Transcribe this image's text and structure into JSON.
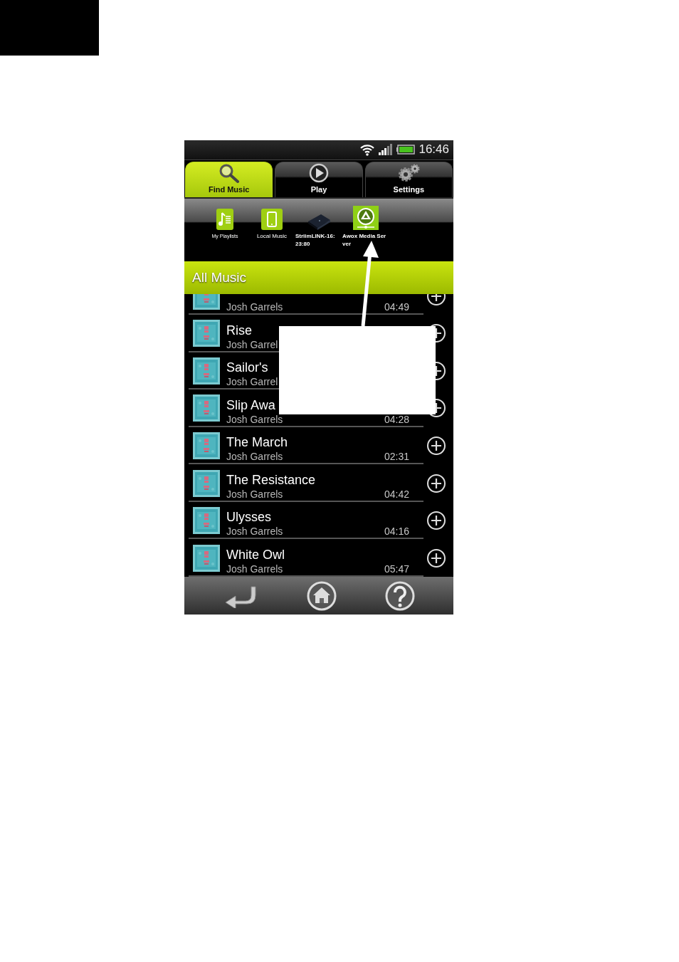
{
  "status_bar": {
    "time": "16:46"
  },
  "tabs": [
    {
      "label": "Find Music",
      "selected": true
    },
    {
      "label": "Play",
      "selected": false
    },
    {
      "label": "Settings",
      "selected": false
    }
  ],
  "sources": [
    {
      "lines": [
        "My Playlists"
      ]
    },
    {
      "lines": [
        "Local Music"
      ]
    },
    {
      "lines": [
        "StriimLINK-16:",
        "23:80"
      ]
    },
    {
      "lines": [
        "Awox Media Ser",
        "ver"
      ]
    }
  ],
  "section_title": "All Music",
  "songs": [
    {
      "artist": "Josh Garrels",
      "duration": "04:49"
    },
    {
      "title": "Rise",
      "artist": "Josh Garrel"
    },
    {
      "title": "Sailor's",
      "artist": "Josh Garrel"
    },
    {
      "title": "Slip Awa",
      "artist": "Josh Garrels",
      "duration": "04:28"
    },
    {
      "title": "The March",
      "artist": "Josh Garrels",
      "duration": "02:31"
    },
    {
      "title": "The Resistance",
      "artist": "Josh Garrels",
      "duration": "04:42"
    },
    {
      "title": "Ulysses",
      "artist": "Josh Garrels",
      "duration": "04:16"
    },
    {
      "title": "White Owl",
      "artist": "Josh Garrels",
      "duration": "05:47"
    }
  ]
}
